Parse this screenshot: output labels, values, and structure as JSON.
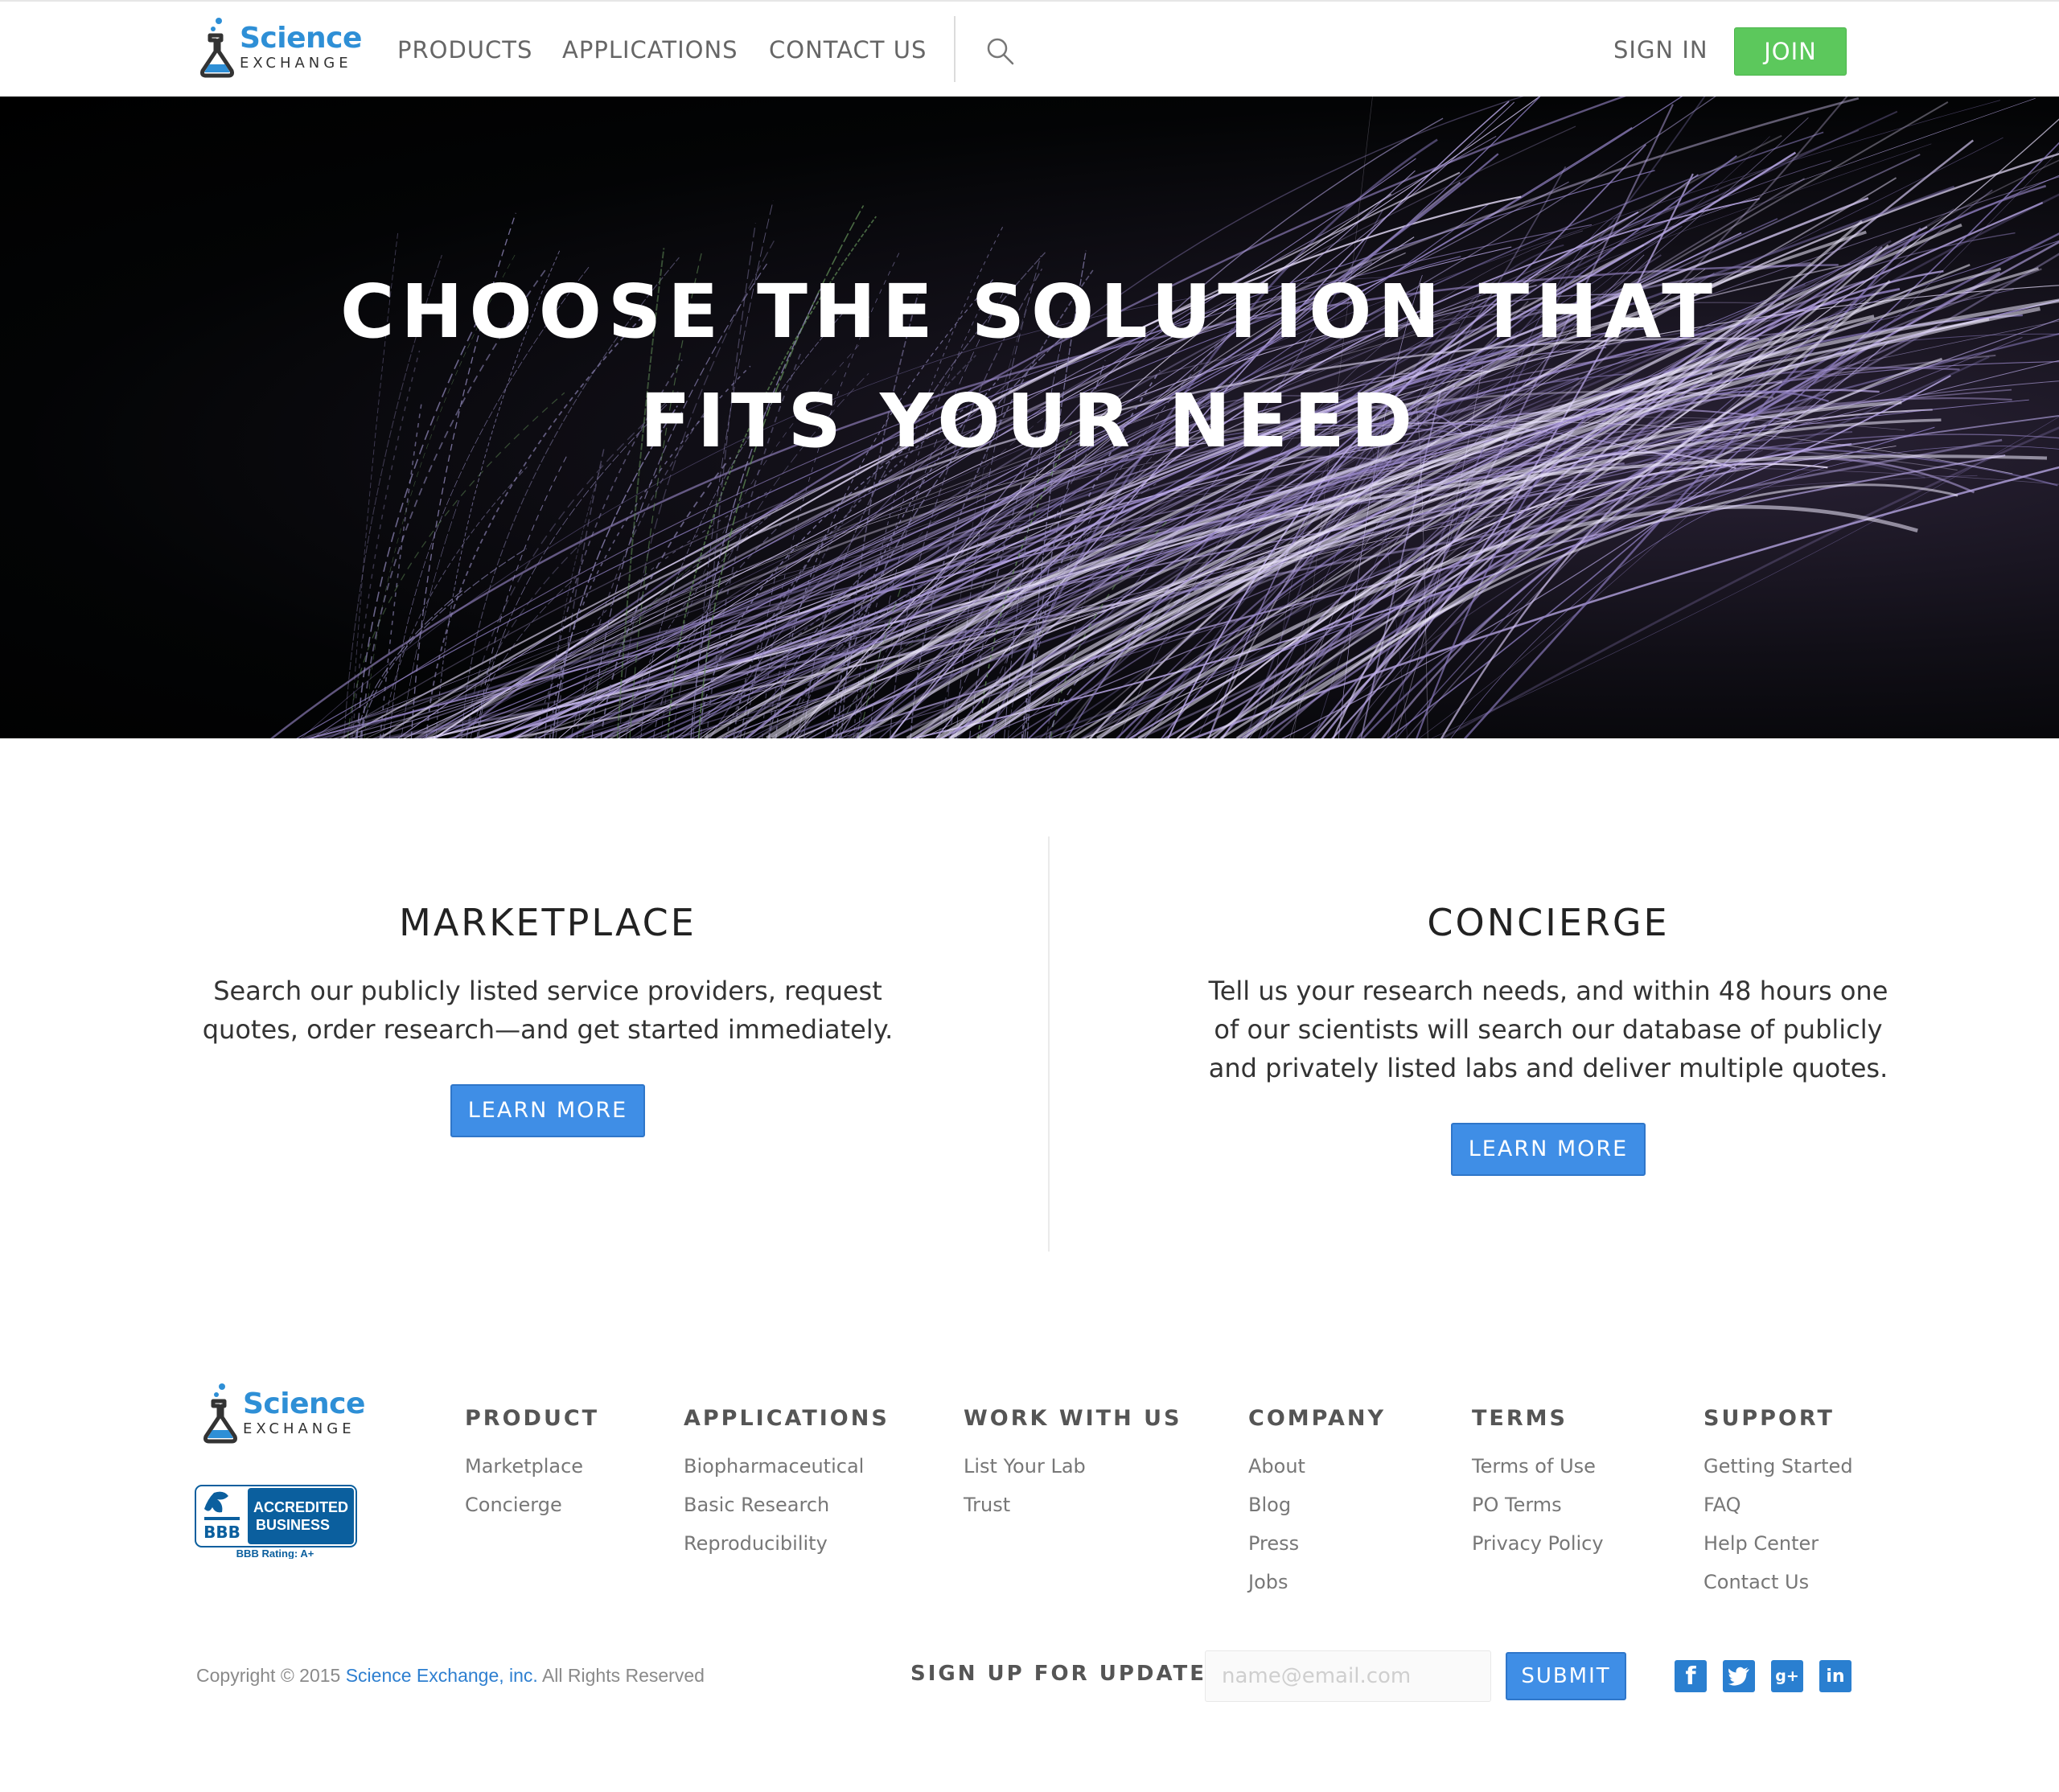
{
  "brand": {
    "line1": "Science",
    "line2": "EXCHANGE",
    "color": "#2e8fd6"
  },
  "header": {
    "nav": [
      "PRODUCTS",
      "APPLICATIONS",
      "CONTACT US"
    ],
    "search_icon": "search-icon",
    "signin_label": "SIGN IN",
    "join_label": "JOIN",
    "join_color": "#5cc85c"
  },
  "hero": {
    "line1": "CHOOSE THE SOLUTION THAT",
    "line2": "FITS YOUR NEED"
  },
  "solutions": [
    {
      "title": "MARKETPLACE",
      "description": "Search our publicly listed service providers, request quotes, order research—and get started immediately.",
      "button": "LEARN MORE"
    },
    {
      "title": "CONCIERGE",
      "description": "Tell us your research needs, and within 48 hours one of our scientists will search our database of publicly and privately listed labs and deliver multiple quotes.",
      "button": "LEARN MORE"
    }
  ],
  "accent_color": "#3f8ee6",
  "footer": {
    "bbb": {
      "line1": "ACCREDITED",
      "line2": "BUSINESS",
      "rating": "BBB Rating: A+",
      "mark": "BBB"
    },
    "columns": [
      {
        "heading": "PRODUCT",
        "links": [
          "Marketplace",
          "Concierge"
        ]
      },
      {
        "heading": "APPLICATIONS",
        "links": [
          "Biopharmaceutical",
          "Basic Research",
          "Reproducibility"
        ]
      },
      {
        "heading": "WORK WITH US",
        "links": [
          "List Your Lab",
          "Trust"
        ]
      },
      {
        "heading": "COMPANY",
        "links": [
          "About",
          "Blog",
          "Press",
          "Jobs"
        ]
      },
      {
        "heading": "TERMS",
        "links": [
          "Terms of Use",
          "PO Terms",
          "Privacy Policy"
        ]
      },
      {
        "heading": "SUPPORT",
        "links": [
          "Getting Started",
          "FAQ",
          "Help Center",
          "Contact Us"
        ]
      }
    ],
    "copyright_prefix": "Copyright © 2015",
    "copyright_company": "Science Exchange, inc.",
    "copyright_suffix": "All Rights Reserved",
    "signup_label": "SIGN UP FOR UPDATES",
    "email_placeholder": "name@email.com",
    "submit_label": "SUBMIT",
    "social": [
      "facebook-icon",
      "twitter-icon",
      "google-plus-icon",
      "linkedin-icon"
    ]
  }
}
